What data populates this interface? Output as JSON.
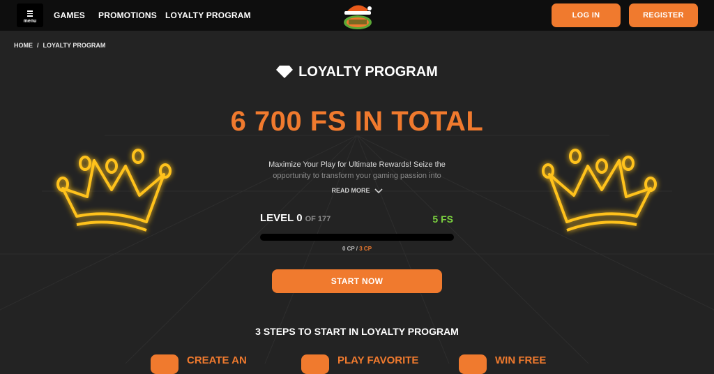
{
  "header": {
    "menu_label": "menu",
    "nav": [
      "GAMES",
      "PROMOTIONS",
      "LOYALTY PROGRAM"
    ],
    "login": "LOG IN",
    "register": "REGISTER"
  },
  "breadcrumb": {
    "home": "HOME",
    "sep": "/",
    "current": "LOYALTY PROGRAM"
  },
  "main": {
    "title": "LOYALTY PROGRAM",
    "hero": "6 700 FS IN TOTAL",
    "desc_line1": "Maximize Your Play for Ultimate Rewards! Seize the",
    "desc_line2": "opportunity to transform your gaming passion into",
    "read_more": "READ MORE",
    "level_label": "LEVEL 0",
    "level_of": "OF 177",
    "reward": "5 FS",
    "progress": 0,
    "cp_current": "0 CP",
    "cp_sep": " / ",
    "cp_target": "3 CP",
    "start": "START NOW",
    "steps_title": "3 STEPS TO START IN LOYALTY PROGRAM",
    "steps": [
      "CREATE AN",
      "PLAY FAVORITE",
      "WIN FREE"
    ]
  },
  "colors": {
    "accent": "#f07a2e",
    "green": "#7bd13f",
    "background": "#232323",
    "topbar": "#0e0e0e",
    "crown_glow": "#ffc21a"
  }
}
